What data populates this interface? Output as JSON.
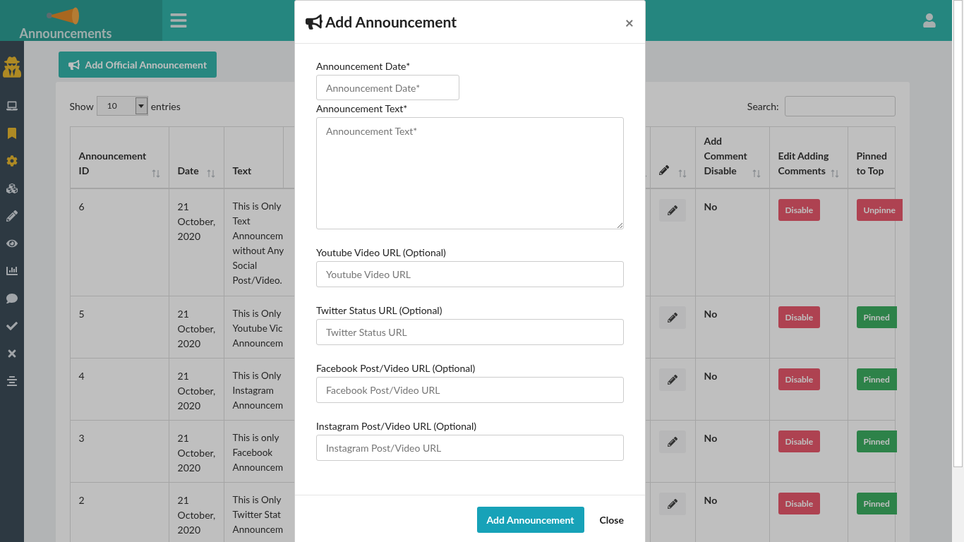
{
  "header": {
    "logo_text": "Announcements"
  },
  "sidebar": {
    "items": [
      {
        "highlighted": true
      },
      {
        "highlighted": false
      },
      {
        "highlighted": true
      },
      {
        "highlighted": true
      },
      {
        "highlighted": false
      },
      {
        "highlighted": false
      },
      {
        "highlighted": false
      },
      {
        "highlighted": false
      },
      {
        "highlighted": false
      },
      {
        "highlighted": false
      },
      {
        "highlighted": false
      },
      {
        "highlighted": false
      }
    ]
  },
  "add_button": "Add Official Announcement",
  "table_controls": {
    "show_label": "Show",
    "entries_value": "10",
    "entries_label": "entries",
    "search_label": "Search:"
  },
  "table": {
    "columns": [
      {
        "label": "Announcement ID",
        "sortable": true
      },
      {
        "label": "Date",
        "sortable": true
      },
      {
        "label": "Text",
        "sortable": false
      },
      {
        "sortable": true
      },
      {
        "sortable": true
      },
      {
        "label": "Add Comment Disable",
        "sortable": true
      },
      {
        "label": "Edit Adding Comments",
        "sortable": true
      },
      {
        "label": "Pinned to Top",
        "sortable": false
      }
    ],
    "rows": [
      {
        "id": "6",
        "date": "21 October, 2020",
        "text": [
          "This is Only",
          "Text",
          "Announcem",
          "without Any",
          "Social",
          "Post/Video."
        ],
        "comment_disabled": "No",
        "edit_button": "Disable",
        "pin": {
          "label": "Unpinne",
          "pinned": false
        }
      },
      {
        "id": "5",
        "date": "21 October, 2020",
        "text": [
          "This is Only",
          "Youtube Vic",
          "Announcem"
        ],
        "comment_disabled": "No",
        "edit_button": "Disable",
        "pin": {
          "label": "Pinned",
          "pinned": true
        }
      },
      {
        "id": "4",
        "date": "21 October, 2020",
        "text": [
          "This is Only",
          "Instagram",
          "Announcem"
        ],
        "comment_disabled": "No",
        "edit_button": "Disable",
        "pin": {
          "label": "Pinned",
          "pinned": true
        }
      },
      {
        "id": "3",
        "date": "21 October, 2020",
        "text": [
          "This is only",
          "Facebook",
          "Announcem"
        ],
        "comment_disabled": "No",
        "edit_button": "Disable",
        "pin": {
          "label": "Pinned",
          "pinned": true
        }
      },
      {
        "id": "2",
        "date": "21 October, 2020",
        "text": [
          "This is Only",
          "Twitter Stat",
          "Announcem"
        ],
        "comment_disabled": "No",
        "edit_button": "Disable",
        "pin": {
          "label": "Pinned",
          "pinned": true
        }
      }
    ]
  },
  "modal": {
    "title": "Add Announcement",
    "close": "×",
    "fields": [
      {
        "label": "Announcement Date*",
        "placeholder": "Announcement Date*",
        "kind": "short"
      },
      {
        "label": "Announcement Text*",
        "placeholder": "Announcement Text*",
        "kind": "textarea"
      },
      {
        "label": "Youtube Video URL (Optional)",
        "placeholder": "Youtube Video URL",
        "kind": "text"
      },
      {
        "label": "Twitter Status URL (Optional)",
        "placeholder": "Twitter Status URL",
        "kind": "text"
      },
      {
        "label": "Facebook Post/Video URL (Optional)",
        "placeholder": "Facebook Post/Video URL",
        "kind": "text"
      },
      {
        "label": "Instagram Post/Video URL (Optional)",
        "placeholder": "Instagram Post/Video URL",
        "kind": "text"
      }
    ],
    "submit": "Add Announcement",
    "cancel": "Close"
  }
}
